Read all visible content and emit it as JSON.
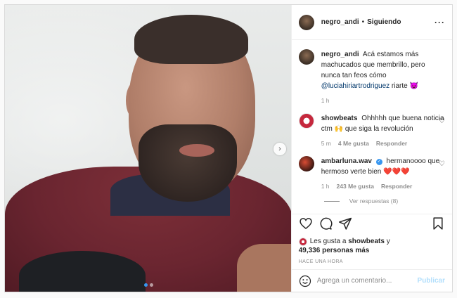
{
  "post": {
    "carousel": {
      "current_slide": 1,
      "total_slides": 2
    },
    "author": {
      "username": "negro_andi",
      "separator": "•",
      "follow_status": "Siguiendo"
    },
    "caption": {
      "username": "negro_andi",
      "text": "Acá estamos más machucados que membrillo, pero nunca tan feos cómo",
      "mention": "@luciahiriartrodriguez",
      "text_after": "riarte",
      "emoji": "😈",
      "time": "1 h"
    },
    "comments": [
      {
        "username": "showbeats",
        "verified": false,
        "text": "Ohhhhh que buena noticia ctm 🙌 que siga la revolución",
        "time": "5 m",
        "likes": "4 Me gusta",
        "reply": "Responder"
      },
      {
        "username": "ambarluna.wav",
        "verified": true,
        "text": "hermanoooo que hermoso verte bien ❤️❤️❤️",
        "time": "1 h",
        "likes": "243 Me gusta",
        "reply": "Responder",
        "view_replies": "Ver respuestas (8)"
      }
    ],
    "liked_by": {
      "prefix": "Les gusta a",
      "user": "showbeats",
      "joiner": "y",
      "count": "49,336 personas más"
    },
    "timestamp": "HACE UNA HORA",
    "add_comment": {
      "placeholder": "Agrega un comentario...",
      "publish": "Publicar"
    },
    "icons": {
      "more": "more-options-icon",
      "like": "heart-icon",
      "comment": "comment-icon",
      "share": "share-icon",
      "save": "bookmark-icon",
      "emoji": "emoji-icon",
      "next": "chevron-right-icon"
    },
    "colors": {
      "link": "#00376b",
      "blue": "#3897f0",
      "publish_disabled": "#b2dffc"
    }
  }
}
